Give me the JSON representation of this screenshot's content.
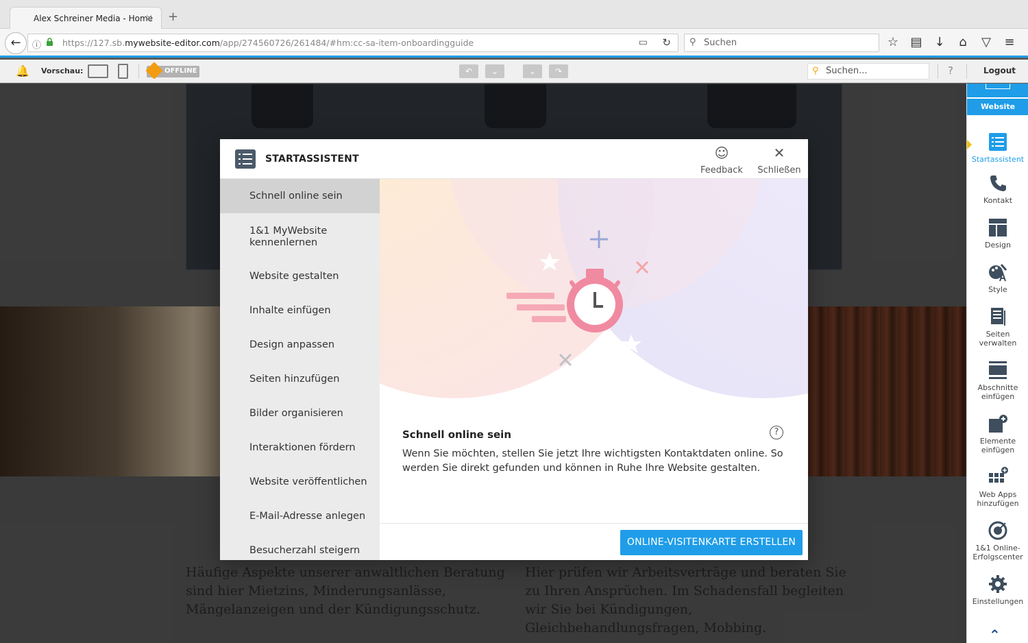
{
  "browser": {
    "tab_title": "Alex Schreiner Media - Home",
    "tab_close": "×",
    "new_tab": "+",
    "url_prefix": "https://127.sb.",
    "url_domain": "mywebsite-editor.com",
    "url_path": "/app/274560726/261484/#hm:cc-sa-item-onboardingguide",
    "search_placeholder": "Suchen",
    "nav_icons": [
      "star-icon",
      "reading-list-icon",
      "download-icon",
      "home-icon",
      "pocket-icon",
      "menu-icon"
    ]
  },
  "toolbar": {
    "preview_label": "Vorschau:",
    "offline_label": "OFFLINE",
    "search_placeholder": "Suchen...",
    "help": "?",
    "logout": "Logout"
  },
  "site": {
    "text_left": "Häufige Aspekte unserer anwaltlichen Beratung sind hier Mietzins, Minderungsanlässe, Mängelanzeigen und der Kündigungsschutz.",
    "text_right": "Hier prüfen wir Arbeitsverträge und beraten Sie zu Ihren Ansprüchen. Im Schadensfall begleiten wir Sie bei Kündigungen, Gleichbehandlungsfragen, Mobbing."
  },
  "sidebar": {
    "header": "Website",
    "items": [
      {
        "label": "Startassistent",
        "icon": "checklist-icon",
        "active": true
      },
      {
        "label": "Kontakt",
        "icon": "phone-icon"
      },
      {
        "label": "Design",
        "icon": "layout-icon"
      },
      {
        "label": "Style",
        "icon": "palette-icon"
      },
      {
        "label": "Seiten verwalten",
        "icon": "pages-icon"
      },
      {
        "label": "Abschnitte einfügen",
        "icon": "sections-icon"
      },
      {
        "label": "Elemente einfügen",
        "icon": "elements-icon"
      },
      {
        "label": "Web Apps hinzufügen",
        "icon": "apps-grid-icon"
      },
      {
        "label": "1&1 Online-Erfolgscenter",
        "icon": "success-center-icon"
      },
      {
        "label": "Einstellungen",
        "icon": "gear-icon"
      }
    ]
  },
  "modal": {
    "title": "STARTASSISTENT",
    "feedback": "Feedback",
    "close": "Schließen",
    "menu": [
      "Schnell online sein",
      "1&1 MyWebsite kennenlernen",
      "Website gestalten",
      "Inhalte einfügen",
      "Design anpassen",
      "Seiten hinzufügen",
      "Bilder organisieren",
      "Interaktionen fördern",
      "Website veröffentlichen",
      "E-Mail-Adresse anlegen",
      "Besucherzahl steigern"
    ],
    "active_index": 0,
    "content_title": "Schnell online sein",
    "content_text": "Wenn Sie möchten, stellen Sie jetzt Ihre wichtigsten Kontaktdaten online. So werden Sie direkt gefunden und können in Ruhe Ihre Website gestalten.",
    "cta": "ONLINE-VISITENKARTE ERSTELLEN"
  },
  "colors": {
    "accent": "#1f9de8",
    "offline_badge": "#f39c12",
    "illustration_pink": "#f08aa0"
  }
}
